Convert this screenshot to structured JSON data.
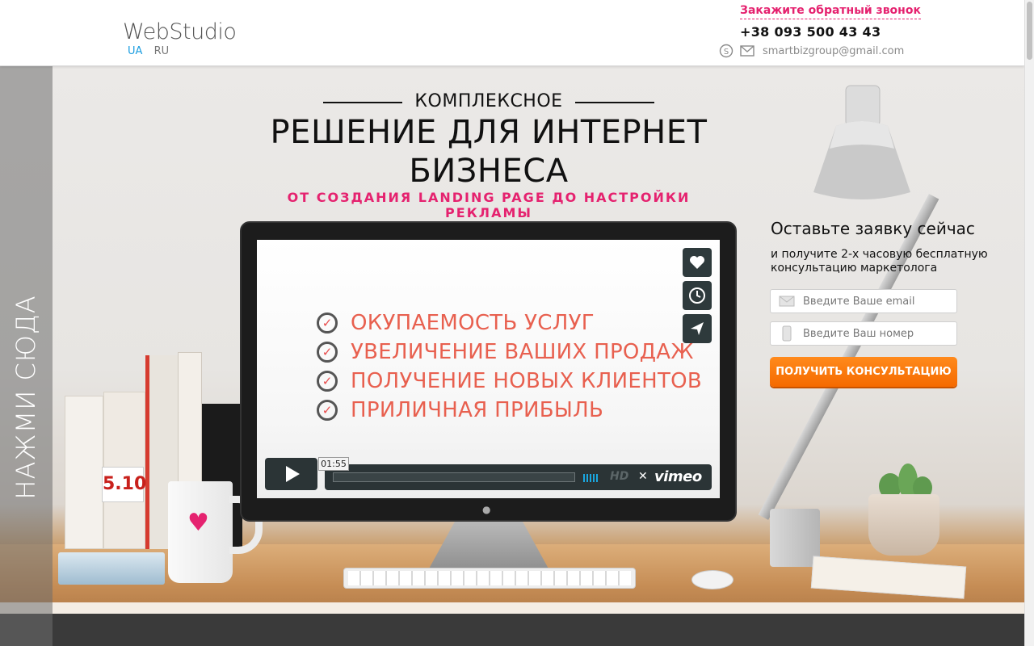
{
  "header": {
    "logo": "WebStudio",
    "lang_ua": "UA",
    "lang_ru": "RU",
    "callback_link": "Закажите обратный звонок",
    "phone": "+38 093 500 43 43",
    "email": "smartbizgroup@gmail.com",
    "skype_icon": "skype-icon",
    "mail_icon": "mail-icon"
  },
  "side_tab": {
    "label": "НАЖМИ СЮДА"
  },
  "hero": {
    "pretitle": "КОМПЛЕКСНОЕ",
    "title_line1": "РЕШЕНИЕ ДЛЯ ИНТЕРНЕТ",
    "title_line2": "БИЗНЕСА",
    "subtitle": "ОТ СОЗДАНИЯ LANDING PAGE ДО НАСТРОЙКИ РЕКЛАМЫ"
  },
  "video": {
    "benefits": [
      "ОКУПАЕМОСТЬ УСЛУГ",
      "УВЕЛИЧЕНИЕ ВАШИХ ПРОДАЖ",
      "ПОЛУЧЕНИЕ НОВЫХ КЛИЕНТОВ",
      "ПРИЛИЧНАЯ ПРИБЫЛЬ"
    ],
    "time": "01:55",
    "hd": "HD",
    "brand": "vimeo",
    "side_buttons": [
      "heart-icon",
      "clock-icon",
      "send-icon"
    ],
    "accent_color": "#1aa7e0"
  },
  "form": {
    "title": "Оставьте заявку сейчас",
    "subtitle": "и получите 2-х часовую бесплатную консультацию маркетолога",
    "email_placeholder": "Введите Ваше email",
    "phone_placeholder": "Введите Ваш номер",
    "submit": "ПОЛУЧИТЬ КОНСУЛЬТАЦИЮ",
    "button_color": "#f56a00"
  },
  "decor": {
    "book_label": "5.10",
    "accent_pink": "#e5226f"
  }
}
